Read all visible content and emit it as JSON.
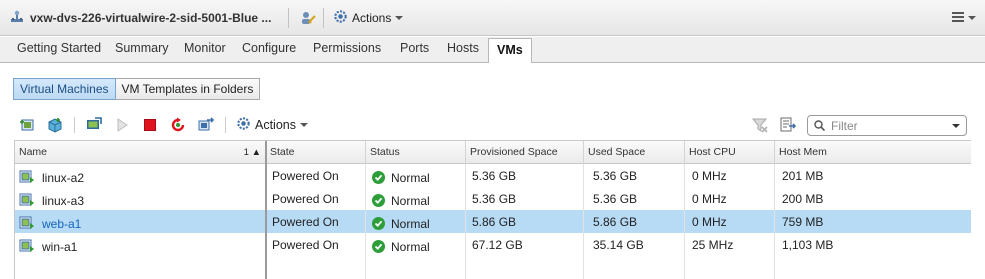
{
  "window": {
    "title": "vxw-dvs-226-virtualwire-2-sid-5001-Blue ...",
    "actions_label": "Actions"
  },
  "tabs": [
    {
      "label": "Getting Started"
    },
    {
      "label": "Summary"
    },
    {
      "label": "Monitor"
    },
    {
      "label": "Configure"
    },
    {
      "label": "Permissions"
    },
    {
      "label": "Ports"
    },
    {
      "label": "Hosts"
    },
    {
      "label": "VMs",
      "active": true
    }
  ],
  "subtabs": [
    {
      "label": "Virtual Machines",
      "active": true
    },
    {
      "label": "VM Templates in Folders"
    }
  ],
  "toolbar": {
    "actions_label": "Actions",
    "icons": [
      "new-vm-icon",
      "deploy-ovf-icon",
      "open-console-icon",
      "power-on-icon",
      "power-off-icon",
      "restart-icon",
      "migrate-icon",
      "settings-icon",
      "clear-filter-icon",
      "export-list-icon"
    ]
  },
  "filter": {
    "placeholder": "Filter",
    "value": ""
  },
  "table": {
    "columns": [
      "Name",
      "State",
      "Status",
      "Provisioned Space",
      "Used Space",
      "Host CPU",
      "Host Mem"
    ],
    "sort_indicator": "1 ▲",
    "rows": [
      {
        "name": "linux-a2",
        "state": "Powered On",
        "status": "Normal",
        "provisioned": "5.36  GB",
        "used": "5.36  GB",
        "cpu": "0 MHz",
        "mem": "201 MB"
      },
      {
        "name": "linux-a3",
        "state": "Powered On",
        "status": "Normal",
        "provisioned": "5.36  GB",
        "used": "5.36  GB",
        "cpu": "0 MHz",
        "mem": "200 MB"
      },
      {
        "name": "web-a1",
        "state": "Powered On",
        "status": "Normal",
        "provisioned": "5.86  GB",
        "used": "5.86  GB",
        "cpu": "0 MHz",
        "mem": "759 MB",
        "selected": true
      },
      {
        "name": "win-a1",
        "state": "Powered On",
        "status": "Normal",
        "provisioned": "67.12  GB",
        "used": "35.14  GB",
        "cpu": "25 MHz",
        "mem": "1,103 MB"
      }
    ]
  },
  "colors": {
    "selected_row": "#b7daf5",
    "status_ok": "#2e9e3b",
    "link_selected": "#1565c0"
  }
}
